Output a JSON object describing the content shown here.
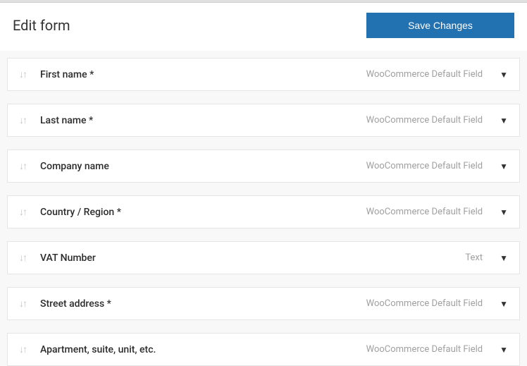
{
  "header": {
    "title": "Edit form",
    "save_label": "Save Changes"
  },
  "field_type_labels": {
    "default": "WooCommerce Default Field",
    "text": "Text"
  },
  "fields": [
    {
      "label": "First name *",
      "type": "default"
    },
    {
      "label": "Last name *",
      "type": "default"
    },
    {
      "label": "Company name",
      "type": "default"
    },
    {
      "label": "Country / Region *",
      "type": "default"
    },
    {
      "label": "VAT Number",
      "type": "text"
    },
    {
      "label": "Street address *",
      "type": "default"
    },
    {
      "label": "Apartment, suite, unit, etc.",
      "type": "default"
    }
  ]
}
